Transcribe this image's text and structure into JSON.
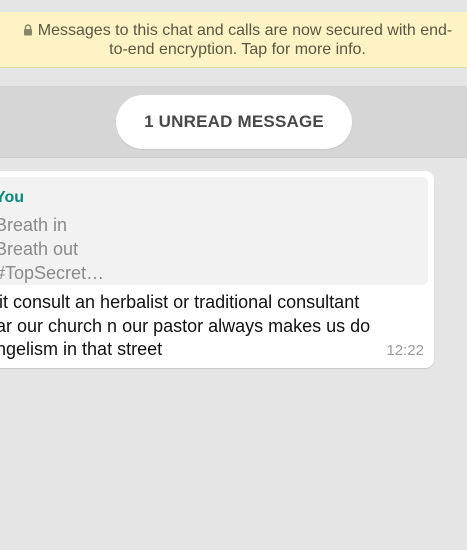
{
  "encryption_banner": {
    "text": "Messages to this chat and calls are now secured with end-to-end encryption. Tap for more info.",
    "icon": "lock-icon"
  },
  "unread": {
    "label": "1 UNREAD MESSAGE"
  },
  "message": {
    "quote": {
      "author": "You",
      "lines": [
        "Breath in",
        "Breath out",
        "#TopSecret…"
      ]
    },
    "text_lines": [
      "isit consult an herbalist or traditional consultant",
      "ear our church n our pastor always makes us do",
      "angelism in that street"
    ],
    "time": "12:22"
  },
  "colors": {
    "chat_background": "#e5e5e5",
    "banner_background": "#fdf3c4",
    "quote_author": "#06897a"
  }
}
